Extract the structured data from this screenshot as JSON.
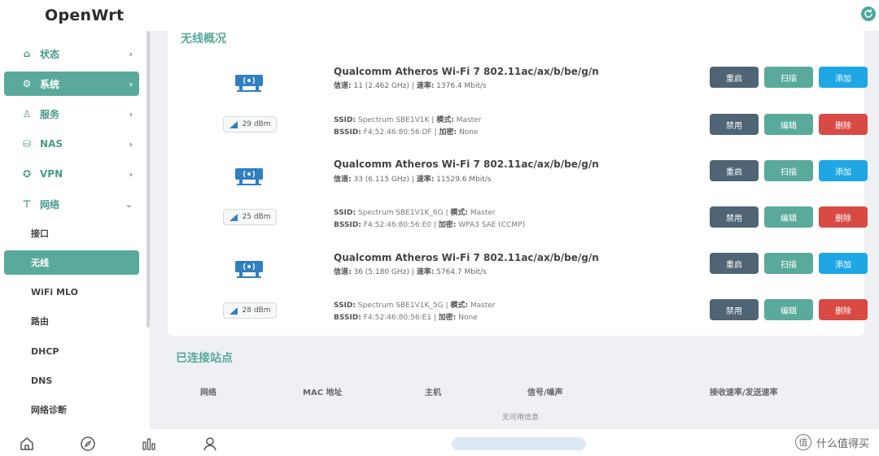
{
  "header": {
    "brand": "OpenWrt",
    "refresh_icon": "refresh-icon"
  },
  "sidebar": {
    "items": [
      {
        "label": "状态",
        "icon": "home-icon",
        "chevron": "›"
      },
      {
        "label": "系统",
        "icon": "gear-icon",
        "chevron": "›"
      },
      {
        "label": "服务",
        "icon": "user-icon",
        "chevron": "›"
      },
      {
        "label": "NAS",
        "icon": "disk-icon",
        "chevron": "›"
      },
      {
        "label": "VPN",
        "icon": "globe-icon",
        "chevron": "›"
      },
      {
        "label": "网络",
        "icon": "network-icon",
        "chevron": "⌄"
      }
    ],
    "subitems": [
      {
        "label": "接口"
      },
      {
        "label": "无线"
      },
      {
        "label": "WiFi MLO"
      },
      {
        "label": "路由"
      },
      {
        "label": "DHCP"
      },
      {
        "label": "DNS"
      },
      {
        "label": "网络诊断"
      }
    ]
  },
  "wireless": {
    "title": "无线概况",
    "devices": [
      {
        "name": "Qualcomm Atheros Wi-Fi 7 802.11ac/ax/b/be/g/n",
        "channel_label": "信道:",
        "channel": "11 (2.462 GHz)",
        "rate_label": "速率:",
        "rate": "1376.4 Mbit/s",
        "signal": "29 dBm",
        "ssid_label": "SSID:",
        "ssid": "Spectrum SBE1V1K",
        "mode_label": "模式:",
        "mode": "Master",
        "bssid_label": "BSSID:",
        "bssid": "F4:52:46:80:56:DF",
        "enc_label": "加密:",
        "enc": "None"
      },
      {
        "name": "Qualcomm Atheros Wi-Fi 7 802.11ac/ax/b/be/g/n",
        "channel_label": "信道:",
        "channel": "33 (6.115 GHz)",
        "rate_label": "速率:",
        "rate": "11529.6 Mbit/s",
        "signal": "25 dBm",
        "ssid_label": "SSID:",
        "ssid": "Spectrum SBE1V1K_6G",
        "mode_label": "模式:",
        "mode": "Master",
        "bssid_label": "BSSID:",
        "bssid": "F4:52:46:80:56:E0",
        "enc_label": "加密:",
        "enc": "WPA3 SAE (CCMP)"
      },
      {
        "name": "Qualcomm Atheros Wi-Fi 7 802.11ac/ax/b/be/g/n",
        "channel_label": "信道:",
        "channel": "36 (5.180 GHz)",
        "rate_label": "速率:",
        "rate": "5764.7 Mbit/s",
        "signal": "28 dBm",
        "ssid_label": "SSID:",
        "ssid": "Spectrum SBE1V1K_5G",
        "mode_label": "模式:",
        "mode": "Master",
        "bssid_label": "BSSID:",
        "bssid": "F4:52:46:80:56:E1",
        "enc_label": "加密:",
        "enc": "None"
      }
    ],
    "buttons": {
      "restart": "重启",
      "scan": "扫描",
      "add": "添加",
      "disable": "禁用",
      "edit": "编辑",
      "delete": "删除"
    }
  },
  "stations": {
    "title": "已连接站点",
    "columns": [
      "网络",
      "MAC 地址",
      "主机",
      "信号/噪声",
      "接收速率/发送速率"
    ],
    "empty": "无可用信息"
  },
  "watermark": {
    "symbol": "值",
    "text": "什么值得买"
  },
  "colors": {
    "accent": "#5aaa9b",
    "dark_button": "#4f6475",
    "blue_button": "#1ea7e4",
    "red_button": "#d84a43"
  }
}
